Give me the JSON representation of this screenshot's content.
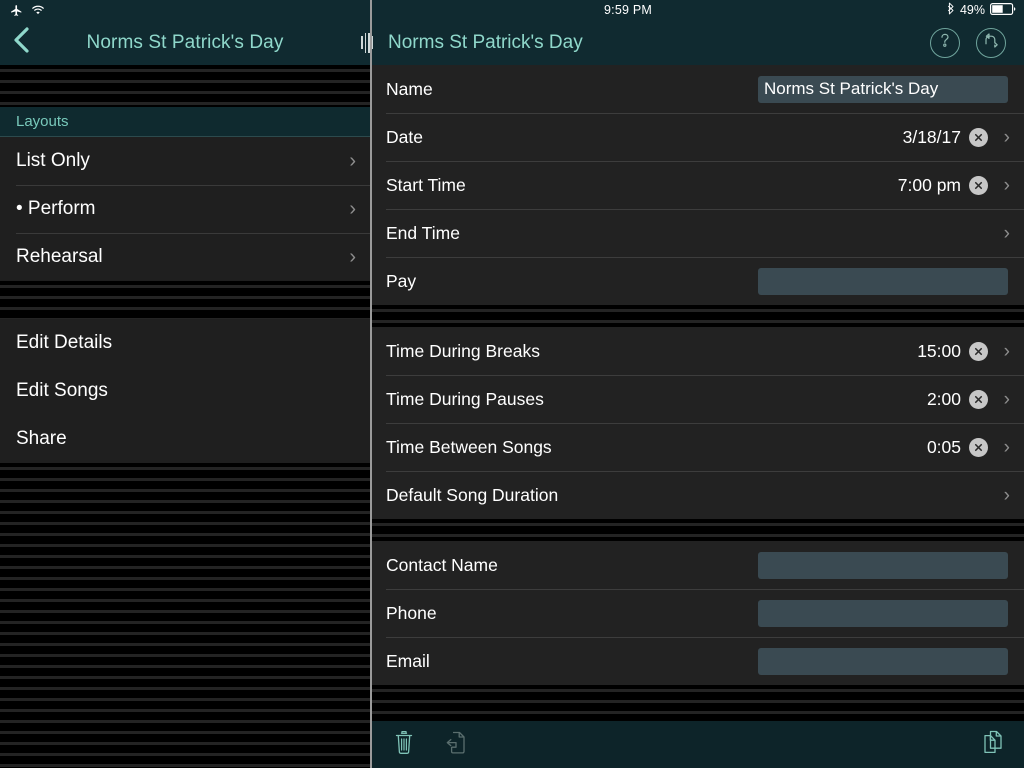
{
  "status_bar": {
    "airplane_icon": "airplane-icon",
    "wifi_icon": "wifi-icon",
    "time": "9:59 PM",
    "bluetooth_icon": "bluetooth-icon",
    "battery_percent": "49%",
    "battery_level": 49
  },
  "sidebar": {
    "back_icon": "back-chevron-icon",
    "title": "Norms St Patrick's Day",
    "section_header": "Layouts",
    "layouts": [
      {
        "label": "List Only",
        "chevron": "›"
      },
      {
        "label": "• Perform",
        "chevron": "›"
      },
      {
        "label": "Rehearsal",
        "chevron": "›"
      }
    ],
    "actions": [
      {
        "label": "Edit Details"
      },
      {
        "label": "Edit Songs"
      },
      {
        "label": "Share"
      }
    ]
  },
  "detail": {
    "drag_handle": "split-drag-handle",
    "title": "Norms St Patrick's Day",
    "help_icon": "question-mark-icon",
    "sync_icon": "refresh-sync-icon",
    "groups": [
      {
        "name": "event-info",
        "rows": [
          {
            "label": "Name",
            "type": "input",
            "value": "Norms St Patrick's Day",
            "placeholder": ""
          },
          {
            "label": "Date",
            "type": "value",
            "value": "3/18/17",
            "clear": true,
            "chevron": "›"
          },
          {
            "label": "Start Time",
            "type": "value",
            "value": "7:00 pm",
            "clear": true,
            "chevron": "›"
          },
          {
            "label": "End Time",
            "type": "value",
            "value": "",
            "clear": false,
            "chevron": "›"
          },
          {
            "label": "Pay",
            "type": "input",
            "value": "",
            "placeholder": ""
          }
        ]
      },
      {
        "name": "timing-settings",
        "rows": [
          {
            "label": "Time During Breaks",
            "type": "value",
            "value": "15:00",
            "clear": true,
            "chevron": "›"
          },
          {
            "label": "Time During Pauses",
            "type": "value",
            "value": "2:00",
            "clear": true,
            "chevron": "›"
          },
          {
            "label": "Time Between Songs",
            "type": "value",
            "value": "0:05",
            "clear": true,
            "chevron": "›"
          },
          {
            "label": "Default Song Duration",
            "type": "value",
            "value": "",
            "clear": false,
            "chevron": "›"
          }
        ]
      },
      {
        "name": "contact-info",
        "rows": [
          {
            "label": "Contact Name",
            "type": "input",
            "value": "",
            "placeholder": ""
          },
          {
            "label": "Phone",
            "type": "input",
            "value": "",
            "placeholder": ""
          },
          {
            "label": "Email",
            "type": "input",
            "value": "",
            "placeholder": ""
          }
        ]
      }
    ]
  },
  "toolbar": {
    "delete_icon": "trash-icon",
    "move_icon": "move-document-icon",
    "duplicate_icon": "duplicate-documents-icon"
  },
  "colors": {
    "accent_teal": "#8fd8cb",
    "navbar_bg": "#102a30",
    "toolbar_bg": "#0d2429",
    "row_bg": "#222222",
    "sidebar_row_bg": "#1f1f1f",
    "input_bg": "#3a4a52",
    "section_header_bg": "#0f2a2f",
    "divider": "#9b9b9b"
  }
}
